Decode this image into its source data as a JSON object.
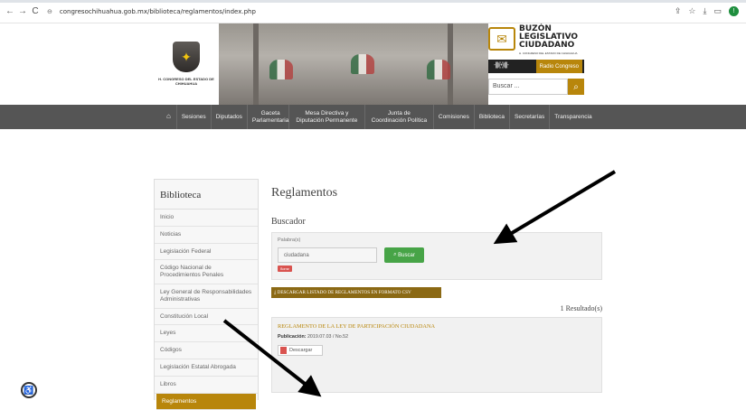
{
  "browser": {
    "url": "congresochihuahua.gob.mx/biblioteca/reglamentos/index.php",
    "profile_initial": "!"
  },
  "header": {
    "logo_text": "H. CONGRESO DEL ESTADO DE CHIHUAHUA",
    "buzon_title": "BUZÓN LEGISLATIVO CIUDADANO",
    "buzon_sub": "H. CONGRESO DEL ESTADO DE CHIHUAHUA",
    "radio_label": "Radio Congreso",
    "search_placeholder": "Buscar ..."
  },
  "nav": {
    "items": [
      "Sesiones",
      "Diputados",
      "Gaceta Parlamentaria",
      "Mesa Directiva y Diputación Permanente",
      "Junta de Coordinación Política",
      "Comisiones",
      "Biblioteca",
      "Secretarías",
      "Transparencia"
    ]
  },
  "sidebar": {
    "title": "Biblioteca",
    "items": [
      "Inicio",
      "Noticias",
      "Legislación Federal",
      "Código Nacional de Procedimientos Penales",
      "Ley General de Responsabilidades Administrativas",
      "Constitución Local",
      "Leyes",
      "Códigos",
      "Legislación Estatal Abrogada",
      "Libros",
      "Reglamentos"
    ],
    "active": "Reglamentos"
  },
  "main": {
    "title": "Reglamentos",
    "subtitle": "Buscador",
    "form": {
      "label": "Palabra(s)",
      "value": "ciudadana",
      "search_button": "Buscar",
      "clear_button": "Borrar"
    },
    "csv_button": "DESCARGAR LISTADO DE REGLAMENTOS EN FORMATO CSV",
    "results_count": "1 Resultado(s)",
    "result": {
      "title": "REGLAMENTO DE LA LEY DE PARTICIPACIÓN CIUDADANA",
      "pub_label": "Publicación:",
      "pub_value": "2019.07.03 / No.52",
      "download": "Descargar"
    }
  },
  "colors": {
    "accent": "#b8860b",
    "nav_bg": "#555555",
    "green_button": "#47a447",
    "red_button": "#d9534f"
  }
}
